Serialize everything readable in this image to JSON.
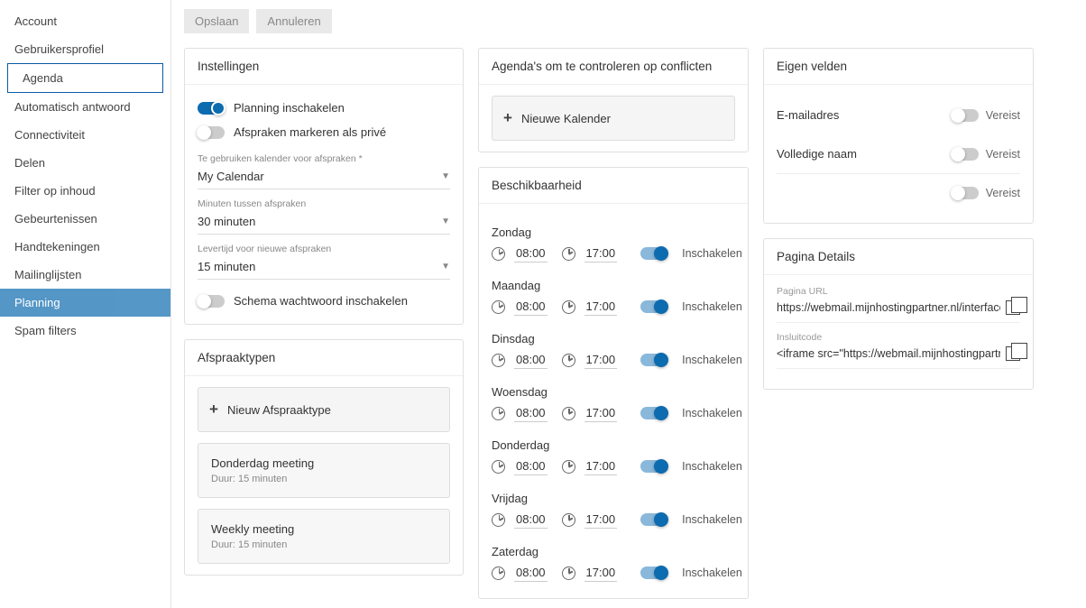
{
  "sidebar": {
    "items": [
      {
        "label": "Account"
      },
      {
        "label": "Gebruikersprofiel"
      },
      {
        "label": "Agenda",
        "outlined": true
      },
      {
        "label": "Automatisch antwoord"
      },
      {
        "label": "Connectiviteit"
      },
      {
        "label": "Delen"
      },
      {
        "label": "Filter op inhoud"
      },
      {
        "label": "Gebeurtenissen"
      },
      {
        "label": "Handtekeningen"
      },
      {
        "label": "Mailinglijsten"
      },
      {
        "label": "Planning",
        "active": true
      },
      {
        "label": "Spam filters"
      }
    ]
  },
  "toolbar": {
    "save": "Opslaan",
    "cancel": "Annuleren"
  },
  "settings": {
    "header": "Instellingen",
    "enable_scheduling": "Planning inschakelen",
    "mark_private": "Afspraken markeren als privé",
    "cal_label": "Te gebruiken kalender voor afspraken *",
    "cal_value": "My Calendar",
    "minutes_label": "Minuten tussen afspraken",
    "minutes_value": "30 minuten",
    "lead_label": "Levertijd voor nieuwe afspraken",
    "lead_value": "15 minuten",
    "password": "Schema wachtwoord inschakelen"
  },
  "types": {
    "header": "Afspraaktypen",
    "add": "Nieuw Afspraaktype",
    "items": [
      {
        "name": "Donderdag meeting",
        "duration": "Duur: 15 minuten"
      },
      {
        "name": "Weekly meeting",
        "duration": "Duur: 15 minuten"
      }
    ]
  },
  "calendars_check": {
    "header": "Agenda's om te controleren op conflicten",
    "add": "Nieuwe Kalender"
  },
  "availability": {
    "header": "Beschikbaarheid",
    "enable": "Inschakelen",
    "days": [
      {
        "name": "Zondag",
        "from": "08:00",
        "to": "17:00"
      },
      {
        "name": "Maandag",
        "from": "08:00",
        "to": "17:00"
      },
      {
        "name": "Dinsdag",
        "from": "08:00",
        "to": "17:00"
      },
      {
        "name": "Woensdag",
        "from": "08:00",
        "to": "17:00"
      },
      {
        "name": "Donderdag",
        "from": "08:00",
        "to": "17:00"
      },
      {
        "name": "Vrijdag",
        "from": "08:00",
        "to": "17:00"
      },
      {
        "name": "Zaterdag",
        "from": "08:00",
        "to": "17:00"
      }
    ]
  },
  "own_fields": {
    "header": "Eigen velden",
    "required": "Vereist",
    "email": "E-mailadres",
    "fullname": "Volledige naam"
  },
  "page_details": {
    "header": "Pagina Details",
    "url_label": "Pagina URL",
    "url_value": "https://webmail.mijnhostingpartner.nl/interface/schedu",
    "embed_label": "Insluitcode",
    "embed_value": "<iframe src=\"https://webmail.mijnhostingpartner.nl/int"
  }
}
